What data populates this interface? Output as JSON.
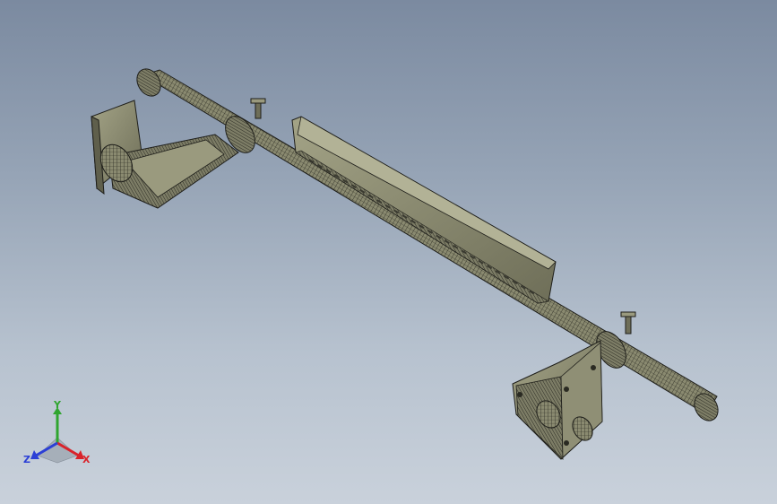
{
  "viewport": {
    "background_top": "#7b8aa0",
    "background_bottom": "#c9d1db"
  },
  "model": {
    "body_color": "#8c8c72",
    "edge_color": "#1e1e1a"
  },
  "triad": {
    "x_label": "X",
    "y_label": "Y",
    "z_label": "Z",
    "x_color": "#d9232b",
    "y_color": "#2fa52f",
    "z_color": "#2b3fd6"
  }
}
